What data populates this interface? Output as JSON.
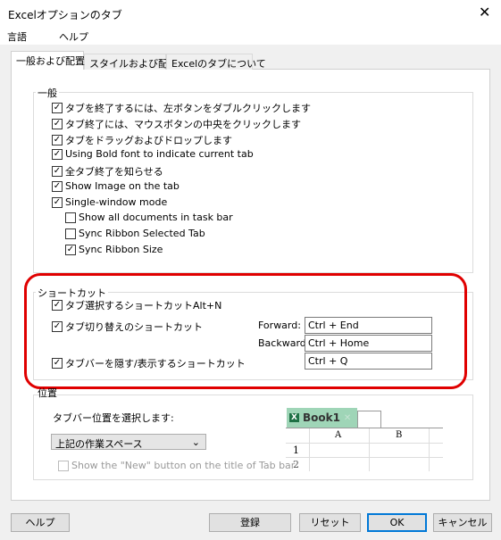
{
  "window": {
    "title": "Excelオプションのタブ",
    "close_icon": "close-icon"
  },
  "menu": [
    "言語",
    "ヘルプ"
  ],
  "tabs": [
    "一般および配置",
    "スタイルおよび配色",
    "Excelのタブについて"
  ],
  "general": {
    "label": "一般",
    "items": [
      {
        "label": "タブを終了するには、左ボタンをダブルクリックします",
        "checked": true
      },
      {
        "label": "タブ終了には、マウスボタンの中央をクリックします",
        "checked": true
      },
      {
        "label": "タブをドラッグおよびドロップします",
        "checked": true
      },
      {
        "label": "Using Bold font to indicate current tab",
        "checked": true
      },
      {
        "label": "全タブ終了を知らせる",
        "checked": true
      },
      {
        "label": "Show Image on the tab",
        "checked": true
      },
      {
        "label": "Single-window mode",
        "checked": true
      },
      {
        "label": "Show all documents in task bar",
        "checked": false
      },
      {
        "label": "Sync Ribbon Selected Tab",
        "checked": false
      },
      {
        "label": "Sync Ribbon Size",
        "checked": true
      }
    ]
  },
  "shortcut": {
    "label": "ショートカット",
    "items": [
      {
        "label": "タブ選択するショートカットAlt+N",
        "checked": true
      },
      {
        "label": "タブ切り替えのショートカット",
        "checked": true
      },
      {
        "label": "タブバーを隠す/表示するショートカット",
        "checked": true
      }
    ],
    "forward_label": "Forward:",
    "forward_value": "Ctrl + End",
    "backward_label": "Backward:",
    "backward_value": "Ctrl + Home",
    "toggle_value": "Ctrl + Q",
    "highlight_color": "#e00000"
  },
  "position": {
    "label": "位置",
    "prompt": "タブバー位置を選択します:",
    "selected": "上記の作業スペース",
    "new_button_option": {
      "label": "Show the \"New\"  button on the title of Tab bar",
      "checked": false,
      "disabled": true
    },
    "preview": {
      "tab": "Book1",
      "columns": [
        "A",
        "B"
      ],
      "rows": [
        "1",
        "2"
      ],
      "tab_color": "#9fd5b7"
    }
  },
  "buttons": {
    "help": "ヘルプ",
    "register": "登録",
    "reset": "リセット",
    "ok": "OK",
    "cancel": "キャンセル"
  }
}
